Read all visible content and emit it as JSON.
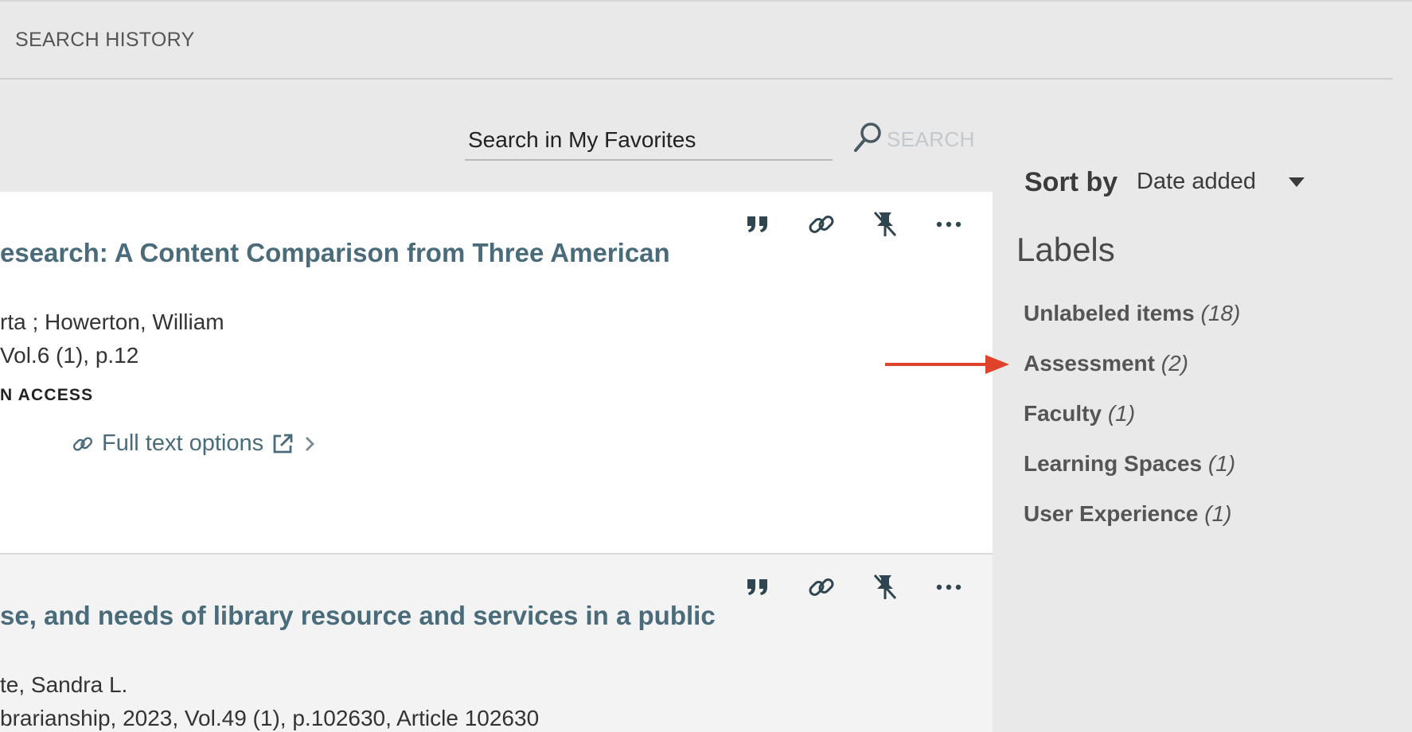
{
  "header": {
    "search_history_tab": "SEARCH HISTORY"
  },
  "search": {
    "placeholder": "Search in My Favorites",
    "button_label": "SEARCH"
  },
  "results": [
    {
      "title": "esearch: A Content Comparison from Three American",
      "authors": "rta ; Howerton, William",
      "source": " Vol.6 (1), p.12",
      "access": "N ACCESS",
      "fulltext_label": "Full text options"
    },
    {
      "title": "se, and needs of library resource and services in a public",
      "authors": "te, Sandra L.",
      "source": "brarianship, 2023, Vol.49 (1), p.102630, Article 102630"
    }
  ],
  "sidebar": {
    "sort_by_label": "Sort by",
    "sort_value": "Date added",
    "labels_heading": "Labels",
    "labels": [
      {
        "name": "Unlabeled items",
        "count": "(18)"
      },
      {
        "name": "Assessment",
        "count": "(2)"
      },
      {
        "name": "Faculty",
        "count": "(1)"
      },
      {
        "name": "Learning Spaces",
        "count": "(1)"
      },
      {
        "name": "User Experience",
        "count": "(1)"
      }
    ]
  },
  "colors": {
    "annotation_arrow": "#e0432b",
    "link": "#4a6b7a"
  }
}
